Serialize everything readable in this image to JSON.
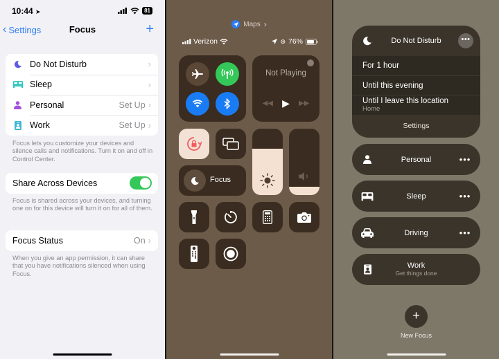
{
  "settings": {
    "status_bar": {
      "time": "10:44",
      "battery": "81"
    },
    "nav": {
      "back_label": "Settings",
      "title": "Focus",
      "add_label": "+"
    },
    "focus_modes": [
      {
        "label": "Do Not Disturb",
        "value": "",
        "icon": "moon-icon",
        "color": "#5e5ce6"
      },
      {
        "label": "Sleep",
        "value": "",
        "icon": "bed-icon",
        "color": "#2fc8c0"
      },
      {
        "label": "Personal",
        "value": "Set Up",
        "icon": "person-icon",
        "color": "#a550e0"
      },
      {
        "label": "Work",
        "value": "Set Up",
        "icon": "id-badge-icon",
        "color": "#3fb7d6"
      }
    ],
    "focus_footer": "Focus lets you customize your devices and silence calls and notifications. Turn it on and off in Control Center.",
    "share": {
      "label": "Share Across Devices",
      "enabled": true
    },
    "share_footer": "Focus is shared across your devices, and turning one on for this device will turn it on for all of them.",
    "focus_status": {
      "label": "Focus Status",
      "value": "On"
    },
    "status_footer": "When you give an app permission, it can share that you have notifications silenced when using Focus."
  },
  "control_center": {
    "location_app": "Maps",
    "carrier": "Verizon",
    "battery": "76%",
    "media": {
      "title": "Not Playing"
    },
    "focus_label": "Focus",
    "brightness_level": 0.7,
    "volume_level": 0.12,
    "colors": {
      "airplane": "#5b4736",
      "cellular": "#34c759",
      "wifi": "#1a7cf5",
      "bluetooth": "#1a7cf5",
      "tile": "#3a2c20",
      "rotation_lock": "#f4e1d5",
      "rotation_icon": "#f25b5b"
    }
  },
  "focus_menu": {
    "active": {
      "title": "Do Not Disturb",
      "options": [
        {
          "label": "For 1 hour",
          "sub": ""
        },
        {
          "label": "Until this evening",
          "sub": ""
        },
        {
          "label": "Until I leave this location",
          "sub": "Home"
        }
      ],
      "settings_label": "Settings"
    },
    "modes": [
      {
        "label": "Personal",
        "sub": "",
        "icon": "person-icon",
        "more": true
      },
      {
        "label": "Sleep",
        "sub": "",
        "icon": "bed-icon",
        "more": true
      },
      {
        "label": "Driving",
        "sub": "",
        "icon": "car-icon",
        "more": true
      },
      {
        "label": "Work",
        "sub": "Get things done",
        "icon": "id-badge-icon",
        "more": false
      }
    ],
    "new_focus_label": "New Focus"
  }
}
